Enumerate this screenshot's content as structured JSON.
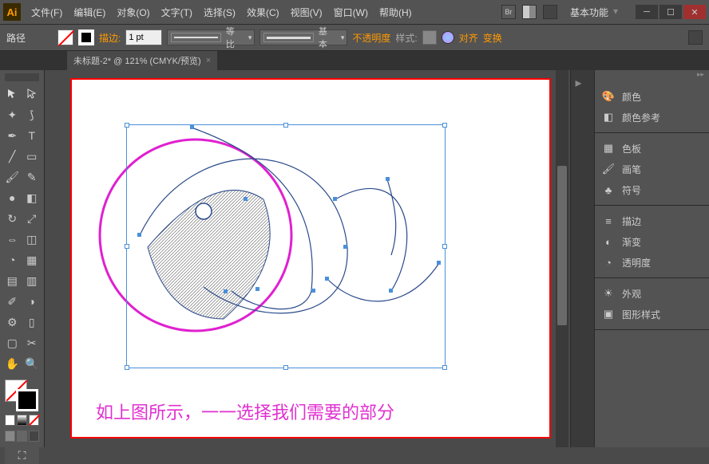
{
  "titlebar": {
    "logo": "Ai",
    "menus": [
      "文件(F)",
      "编辑(E)",
      "对象(O)",
      "文字(T)",
      "选择(S)",
      "效果(C)",
      "视图(V)",
      "窗口(W)",
      "帮助(H)"
    ],
    "workspace": "基本功能"
  },
  "optbar": {
    "path_label": "路径",
    "stroke_label": "描边:",
    "stroke_value": "1 pt",
    "profile_label": "等比",
    "brush_label": "基本",
    "opacity_label": "不透明度",
    "style_label": "样式:",
    "align_label": "对齐",
    "transform_label": "变换"
  },
  "tab": {
    "title": "未标题-2* @ 121% (CMYK/预览)",
    "close": "×"
  },
  "canvas": {
    "caption": "如上图所示，一一选择我们需要的部分"
  },
  "panels": {
    "group1": [
      "颜色",
      "颜色参考"
    ],
    "group2": [
      "色板",
      "画笔",
      "符号"
    ],
    "group3": [
      "描边",
      "渐变",
      "透明度"
    ],
    "group4": [
      "外观",
      "图形样式"
    ]
  },
  "icons": {
    "color": "🎨",
    "guide": "◧",
    "swatch": "▦",
    "brush": "🖌",
    "symbol": "♣",
    "stroke": "≡",
    "gradient": "◐",
    "trans": "◔",
    "appear": "☀",
    "style": "▣"
  }
}
